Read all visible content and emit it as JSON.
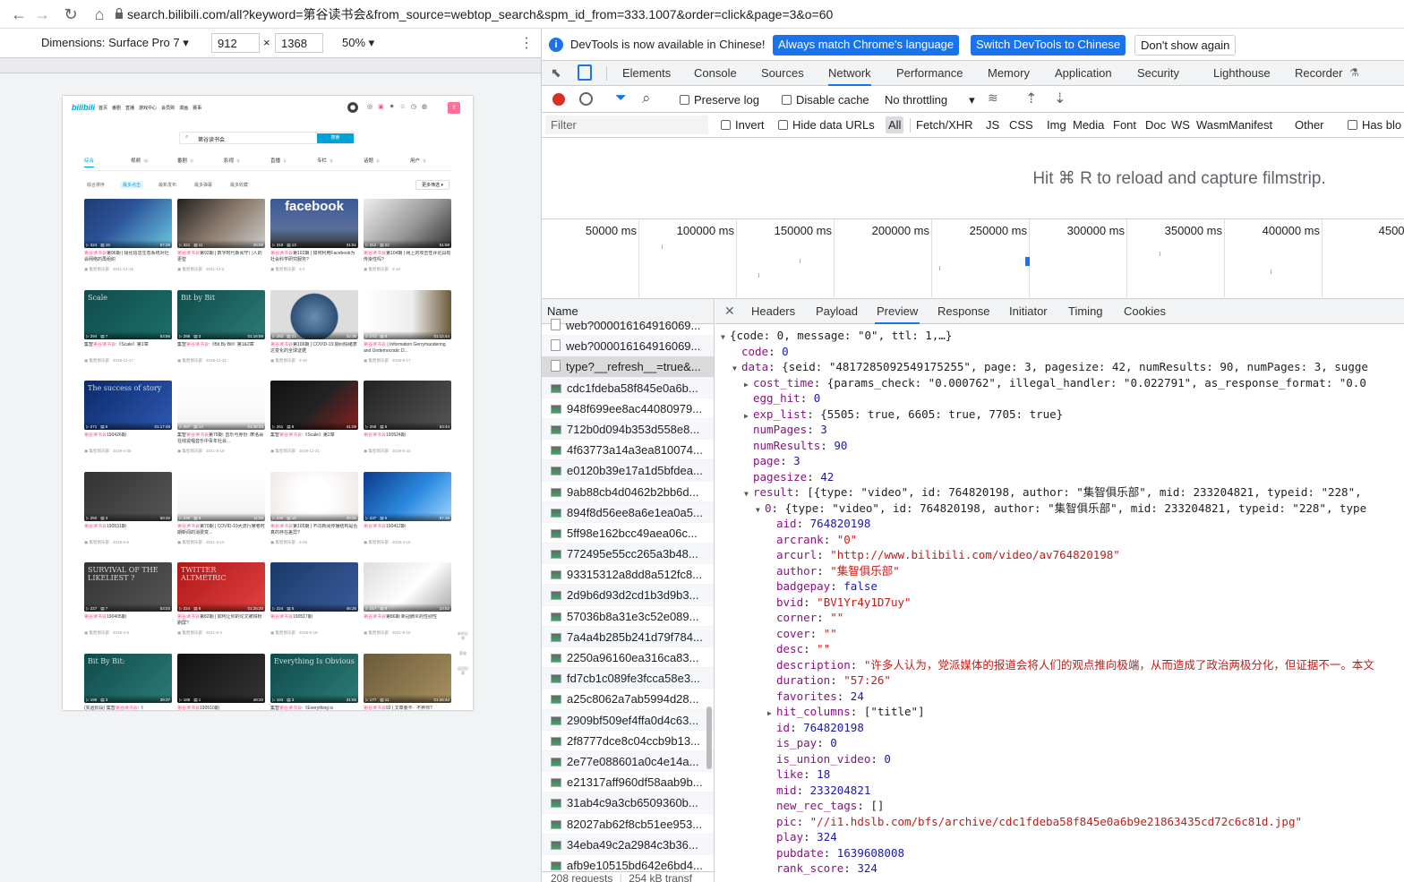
{
  "browser": {
    "url": "search.bilibili.com/all?keyword=第谷读书会&from_source=webtop_search&spm_id_from=333.1007&order=click&page=3&o=60"
  },
  "device_toolbar": {
    "dimensions_label": "Dimensions: Surface Pro 7",
    "width": "912",
    "height": "1368",
    "times": "×",
    "zoom": "50%"
  },
  "bili": {
    "nav": [
      "首页",
      "番剧",
      "直播",
      "游戏中心",
      "会员购",
      "漫画",
      "赛事"
    ],
    "search_value": "第谷读书会",
    "search_btn": "搜索",
    "type_tabs": [
      {
        "label": "综合",
        "count": ""
      },
      {
        "label": "视频",
        "count": "90"
      },
      {
        "label": "番剧",
        "count": "0"
      },
      {
        "label": "影视",
        "count": "0"
      },
      {
        "label": "直播",
        "count": "0"
      },
      {
        "label": "专栏",
        "count": "0"
      },
      {
        "label": "话题",
        "count": "0"
      },
      {
        "label": "用户",
        "count": "0"
      }
    ],
    "sort": [
      "综合排序",
      "最多点击",
      "最新发布",
      "最多弹幕",
      "最多收藏"
    ],
    "more_filter": "更多筛选",
    "side": [
      "新的反馈",
      "客服",
      "返回旧版"
    ],
    "cards": [
      {
        "plays": "324",
        "dm": "18",
        "dur": "57:26",
        "pre": "",
        "hl": "第谷读书会",
        "post": "第96期 | 极化信息生态系统对社会网络的再组织",
        "up": "集智俱乐部",
        "date": "2021-12-16",
        "art": "",
        "bg": "linear-gradient(135deg,#1e3c72,#2a5298 40%,#6bc6e0)"
      },
      {
        "plays": "321",
        "dm": "11",
        "dur": "25:59",
        "pre": "",
        "hl": "第谷读书会",
        "post": "第92期 | 数字时代新闻守门人的更替",
        "up": "集智俱乐部",
        "date": "2021-11-3",
        "art": "",
        "bg": "linear-gradient(135deg,#222,#8a7a6a 50%,#ccc)"
      },
      {
        "plays": "319",
        "dm": "13",
        "dur": "31:51",
        "pre": "",
        "hl": "第谷读书会",
        "post": "第102期 | 如何利用Facebook为社会科学研究服务?",
        "up": "集智俱乐部",
        "date": "3-2",
        "art": "facebook",
        "bg": "linear-gradient(180deg,#3b5998,#5a6f9a 60%,#333)"
      },
      {
        "plays": "312",
        "dm": "22",
        "dur": "51:58",
        "pre": "",
        "hl": "第谷读书会",
        "post": "第104期 | 网上的攻击性评论具有传染性吗?",
        "up": "集智俱乐部",
        "date": "3-16",
        "art": "",
        "bg": "linear-gradient(135deg,#eee,#999 55%,#333)"
      },
      {
        "plays": "294",
        "dm": "7",
        "dur": "53:56",
        "pre": "集智",
        "hl": "第谷读书会",
        "post": ":《Scale》第1章",
        "up": "集智俱乐部",
        "date": "2018-12-17",
        "art": "Scale",
        "bg": "linear-gradient(135deg,#0f4c4c,#1c6e6a)"
      },
      {
        "plays": "286",
        "dm": "3",
        "dur": "01:16:59",
        "pre": "集智",
        "hl": "第谷读书会",
        "post": ":《Bit By Bit》第1&2章",
        "up": "集智俱乐部",
        "date": "2018-12-21",
        "art": "Bit by Bit",
        "bg": "linear-gradient(135deg,#0f4c4c,#2b7a76)"
      },
      {
        "plays": "283",
        "dm": "21",
        "dur": "42:38",
        "pre": "",
        "hl": "第谷读书会",
        "post": "第106期 | COVID-19 期间情绪表达变化的全球证据",
        "up": "集智俱乐部",
        "date": "3-30",
        "art": "",
        "bg": "radial-gradient(circle at 50% 55%,#6a8db5,#2f5075 45%,#ddd 47%)"
      },
      {
        "plays": "273",
        "dm": "8",
        "dur": "01:12:44",
        "pre": "",
        "hl": "第谷读书会",
        "post": " | Information Gerrymandering and Undemocratic D...",
        "up": "集智俱乐部",
        "date": "2019-9-17",
        "art": "",
        "bg": "linear-gradient(90deg,#fff,#eee 55%,#6b5a3a)"
      },
      {
        "plays": "271",
        "dm": "6",
        "dur": "01:17:48",
        "pre": "",
        "hl": "第谷读书会",
        "post": "190426期",
        "up": "集智俱乐部",
        "date": "2019-4-26",
        "art": "The success of story",
        "bg": "linear-gradient(135deg,#0b2a6a,#2e58b0)"
      },
      {
        "plays": "267",
        "dm": "14",
        "dur": "01:46:44",
        "pre": "集智",
        "hl": "第谷读书会",
        "post": "第79期: 音乐与身份: 摩洛哥在线说唱音乐中青年社会...",
        "up": "集智俱乐部",
        "date": "2021-5-19",
        "art": "",
        "bg": "linear-gradient(#fff,#f4f4f4)"
      },
      {
        "plays": "261",
        "dm": "8",
        "dur": "41:08",
        "pre": "集智",
        "hl": "第谷读书会",
        "post": ":《Scale》第2章",
        "up": "集智俱乐部",
        "date": "2018-12-21",
        "art": "",
        "bg": "linear-gradient(135deg,#111,#222 50%,#8a2020)"
      },
      {
        "plays": "258",
        "dm": "6",
        "dur": "53:44",
        "pre": "",
        "hl": "第谷读书会",
        "post": "190524期",
        "up": "集智俱乐部",
        "date": "2019-5-24",
        "art": "",
        "bg": "linear-gradient(135deg,#222,#555)"
      },
      {
        "plays": "250",
        "dm": "3",
        "dur": "58:46",
        "pre": "",
        "hl": "第谷读书会",
        "post": "190531期",
        "up": "集智俱乐部",
        "date": "2019-6-6",
        "art": "",
        "bg": "linear-gradient(135deg,#333,#555)"
      },
      {
        "plays": "240",
        "dm": "6",
        "dur": "11:04",
        "pre": "",
        "hl": "第谷读书会",
        "post": "第70期 | COVID-19大流行席卷时期新闻的消费变...",
        "up": "集智俱乐部",
        "date": "2021-3-10",
        "art": "",
        "bg": "linear-gradient(#fff,#f2f2f2)"
      },
      {
        "plays": "240",
        "dm": "18",
        "dur": "30:31",
        "pre": "",
        "hl": "第谷读书会",
        "post": "第105期 | 不同新闻传播结构是否真的存在差异?",
        "up": "集智俱乐部",
        "date": "3-25",
        "art": "",
        "bg": "radial-gradient(circle,#fff 30%,#f0e8e8)"
      },
      {
        "plays": "237",
        "dm": "5",
        "dur": "57:16",
        "pre": "",
        "hl": "第谷读书会",
        "post": "190412期",
        "up": "集智俱乐部",
        "date": "2019-4-15",
        "art": "",
        "bg": "linear-gradient(135deg,#0a3a8a,#2d8ae0 55%,#9fd6ff)"
      },
      {
        "plays": "227",
        "dm": "7",
        "dur": "53:03",
        "pre": "",
        "hl": "第谷读书会",
        "post": "190405期",
        "up": "集智俱乐部",
        "date": "2019-4-5",
        "art": "SURVIVAL OF THE LIKELIEST ?",
        "bg": "linear-gradient(135deg,#333,#555)"
      },
      {
        "plays": "224",
        "dm": "6",
        "dur": "01:25:20",
        "pre": "",
        "hl": "第谷读书会",
        "post": "第82期 | 如何让你的论文被铁粉刷屏?",
        "up": "集智俱乐部",
        "date": "2021-6-2",
        "art": "TWITTER ALTMETRIC",
        "bg": "linear-gradient(135deg,#b01818,#e04040)"
      },
      {
        "plays": "224",
        "dm": "5",
        "dur": "46:36",
        "pre": "",
        "hl": "第谷读书会",
        "post": "190517期",
        "up": "集智俱乐部",
        "date": "2019-5-19",
        "art": "",
        "bg": "linear-gradient(135deg,#1a3a6a,#3a5a9a)"
      },
      {
        "plays": "217",
        "dm": "9",
        "dur": "23:52",
        "pre": "",
        "hl": "第谷读书会",
        "post": "第86期 新冠肺炎的性别性",
        "up": "集智俱乐部",
        "date": "2021-9-15",
        "art": "",
        "bg": "linear-gradient(135deg,#ddd,#fff 55%,#aaa)"
      },
      {
        "plays": "196",
        "dm": "3",
        "dur": "39:37",
        "pre": "(实验阶段) 集智",
        "hl": "第谷读书会",
        "post": ":《",
        "up": "",
        "date": "",
        "art": "Bit By Bit:",
        "bg": "linear-gradient(135deg,#0f4c4c,#2b7a76)"
      },
      {
        "plays": "188",
        "dm": "1",
        "dur": "48:20",
        "pre": "",
        "hl": "第谷读书会",
        "post": "190510期",
        "up": "",
        "date": "",
        "art": "",
        "bg": "linear-gradient(135deg,#111,#333)"
      },
      {
        "plays": "184",
        "dm": "3",
        "dur": "31:55",
        "pre": "集智",
        "hl": "第谷读书会",
        "post": ":《Everything is",
        "up": "",
        "date": "",
        "art": "Everything Is Obvious",
        "bg": "linear-gradient(135deg,#0f4c4c,#2b7a76)"
      },
      {
        "plays": "177",
        "dm": "11",
        "dur": "01:26:42",
        "pre": "",
        "hl": "第谷读书会",
        "post": "92 | 文章要不 · 不弃你?",
        "up": "",
        "date": "",
        "art": "",
        "bg": "linear-gradient(135deg,#6a5a3a,#a89060)"
      }
    ]
  },
  "devtools": {
    "info_text": "DevTools is now available in Chinese!",
    "info_btn1": "Always match Chrome's language",
    "info_btn2": "Switch DevTools to Chinese",
    "info_btn3": "Don't show again",
    "tabs": [
      "Elements",
      "Console",
      "Sources",
      "Network",
      "Performance",
      "Memory",
      "Application",
      "Security",
      "Lighthouse",
      "Recorder"
    ],
    "preserve_log": "Preserve log",
    "disable_cache": "Disable cache",
    "throttling": "No throttling",
    "filter_placeholder": "Filter",
    "invert": "Invert",
    "hide_data": "Hide data URLs",
    "types": [
      "All",
      "Fetch/XHR",
      "JS",
      "CSS",
      "Img",
      "Media",
      "Font",
      "Doc",
      "WS",
      "Wasm",
      "Manifest",
      "Other"
    ],
    "has_blocked": "Has blo",
    "filmstrip_hint": "Hit ⌘ R to reload and capture filmstrip.",
    "timeline_labels": [
      "50000 ms",
      "100000 ms",
      "150000 ms",
      "200000 ms",
      "250000 ms",
      "300000 ms",
      "350000 ms",
      "400000 ms",
      "450000"
    ],
    "name_header": "Name",
    "requests": [
      {
        "name": "web?000016164916069...",
        "doc": true
      },
      {
        "name": "web?000016164916069...",
        "doc": true
      },
      {
        "name": "type?__refresh__=true&...",
        "doc": true
      },
      {
        "name": "cdc1fdeba58f845e0a6b...",
        "doc": false
      },
      {
        "name": "948f699ee8ac44080979...",
        "doc": false
      },
      {
        "name": "712b0d094b353d558e8...",
        "doc": false
      },
      {
        "name": "4f63773a14a3ea810074...",
        "doc": false
      },
      {
        "name": "e0120b39e17a1d5bfdea...",
        "doc": false
      },
      {
        "name": "9ab88cb4d0462b2bb6d...",
        "doc": false
      },
      {
        "name": "894f8d56ee8a6e1ea0a5...",
        "doc": false
      },
      {
        "name": "5ff98e162bcc49aea06c...",
        "doc": false
      },
      {
        "name": "772495e55cc265a3b48...",
        "doc": false
      },
      {
        "name": "93315312a8dd8a512fc8...",
        "doc": false
      },
      {
        "name": "2d9b6d93d2cd1b3d9b3...",
        "doc": false
      },
      {
        "name": "57036b8a31e3c52e089...",
        "doc": false
      },
      {
        "name": "7a4a4b285b241d79f784...",
        "doc": false
      },
      {
        "name": "2250a96160ea316ca83...",
        "doc": false
      },
      {
        "name": "fd7cb1c089fe3fcca58e3...",
        "doc": false
      },
      {
        "name": "a25c8062a7ab5994d28...",
        "doc": false
      },
      {
        "name": "2909bf509ef4ffa0d4c63...",
        "doc": false
      },
      {
        "name": "2f8777dce8c04ccb9b13...",
        "doc": false
      },
      {
        "name": "2e77e088601a0c4e14a...",
        "doc": false
      },
      {
        "name": "e21317aff960df58aab9b...",
        "doc": false
      },
      {
        "name": "31ab4c9a3cb6509360b...",
        "doc": false
      },
      {
        "name": "82027ab62f8cb51ee953...",
        "doc": false
      },
      {
        "name": "34eba49c2a2984c3b36...",
        "doc": false
      },
      {
        "name": "afb9e10515bd642e6bd4...",
        "doc": false
      }
    ],
    "status": "208 requests",
    "transfer": "254 kB transf",
    "detail_tabs": [
      "Headers",
      "Payload",
      "Preview",
      "Response",
      "Initiator",
      "Timing",
      "Cookies"
    ],
    "preview": [
      {
        "indent": 0,
        "tri": "▼",
        "html": "{code: 0, message: \"0\", ttl: 1,…}"
      },
      {
        "indent": 1,
        "tri": "",
        "k": "code",
        "v": "0",
        "t": "n"
      },
      {
        "indent": 1,
        "tri": "▼",
        "k": "data",
        "v": "{seid: \"4817285092549175255\", page: 3, pagesize: 42, numResults: 90, numPages: 3, sugge",
        "t": "p"
      },
      {
        "indent": 2,
        "tri": "▶",
        "k": "cost_time",
        "v": "{params_check: \"0.000762\", illegal_handler: \"0.022791\", as_response_format: \"0.0",
        "t": "p"
      },
      {
        "indent": 2,
        "tri": "",
        "k": "egg_hit",
        "v": "0",
        "t": "n"
      },
      {
        "indent": 2,
        "tri": "▶",
        "k": "exp_list",
        "v": "{5505: true, 6605: true, 7705: true}",
        "t": "p"
      },
      {
        "indent": 2,
        "tri": "",
        "k": "numPages",
        "v": "3",
        "t": "n"
      },
      {
        "indent": 2,
        "tri": "",
        "k": "numResults",
        "v": "90",
        "t": "n"
      },
      {
        "indent": 2,
        "tri": "",
        "k": "page",
        "v": "3",
        "t": "n"
      },
      {
        "indent": 2,
        "tri": "",
        "k": "pagesize",
        "v": "42",
        "t": "n"
      },
      {
        "indent": 2,
        "tri": "▼",
        "k": "result",
        "v": "[{type: \"video\", id: 764820198, author: \"集智俱乐部\", mid: 233204821, typeid: \"228\",",
        "t": "p"
      },
      {
        "indent": 3,
        "tri": "▼",
        "k": "0",
        "v": "{type: \"video\", id: 764820198, author: \"集智俱乐部\", mid: 233204821, typeid: \"228\", type",
        "t": "p"
      },
      {
        "indent": 4,
        "tri": "",
        "k": "aid",
        "v": "764820198",
        "t": "n"
      },
      {
        "indent": 4,
        "tri": "",
        "k": "arcrank",
        "v": "\"0\"",
        "t": "s"
      },
      {
        "indent": 4,
        "tri": "",
        "k": "arcurl",
        "v": "\"http://www.bilibili.com/video/av764820198\"",
        "t": "s"
      },
      {
        "indent": 4,
        "tri": "",
        "k": "author",
        "v": "\"集智俱乐部\"",
        "t": "s"
      },
      {
        "indent": 4,
        "tri": "",
        "k": "badgepay",
        "v": "false",
        "t": "n"
      },
      {
        "indent": 4,
        "tri": "",
        "k": "bvid",
        "v": "\"BV1Yr4y1D7uy\"",
        "t": "s"
      },
      {
        "indent": 4,
        "tri": "",
        "k": "corner",
        "v": "\"\"",
        "t": "s"
      },
      {
        "indent": 4,
        "tri": "",
        "k": "cover",
        "v": "\"\"",
        "t": "s"
      },
      {
        "indent": 4,
        "tri": "",
        "k": "desc",
        "v": "\"\"",
        "t": "s"
      },
      {
        "indent": 4,
        "tri": "",
        "k": "description",
        "v": "\"许多人认为，党派媒体的报道会将人们的观点推向极端，从而造成了政治两极分化，但证据不一。本文",
        "t": "s"
      },
      {
        "indent": 4,
        "tri": "",
        "k": "duration",
        "v": "\"57:26\"",
        "t": "s"
      },
      {
        "indent": 4,
        "tri": "",
        "k": "favorites",
        "v": "24",
        "t": "n"
      },
      {
        "indent": 4,
        "tri": "▶",
        "k": "hit_columns",
        "v": "[\"title\"]",
        "t": "p"
      },
      {
        "indent": 4,
        "tri": "",
        "k": "id",
        "v": "764820198",
        "t": "n"
      },
      {
        "indent": 4,
        "tri": "",
        "k": "is_pay",
        "v": "0",
        "t": "n"
      },
      {
        "indent": 4,
        "tri": "",
        "k": "is_union_video",
        "v": "0",
        "t": "n"
      },
      {
        "indent": 4,
        "tri": "",
        "k": "like",
        "v": "18",
        "t": "n"
      },
      {
        "indent": 4,
        "tri": "",
        "k": "mid",
        "v": "233204821",
        "t": "n"
      },
      {
        "indent": 4,
        "tri": "",
        "k": "new_rec_tags",
        "v": "[]",
        "t": "p"
      },
      {
        "indent": 4,
        "tri": "",
        "k": "pic",
        "v": "\"//i1.hdslb.com/bfs/archive/cdc1fdeba58f845e0a6b9e21863435cd72c6c81d.jpg\"",
        "t": "s"
      },
      {
        "indent": 4,
        "tri": "",
        "k": "play",
        "v": "324",
        "t": "n"
      },
      {
        "indent": 4,
        "tri": "",
        "k": "pubdate",
        "v": "1639608008",
        "t": "n"
      },
      {
        "indent": 4,
        "tri": "",
        "k": "rank_score",
        "v": "324",
        "t": "n"
      }
    ]
  }
}
